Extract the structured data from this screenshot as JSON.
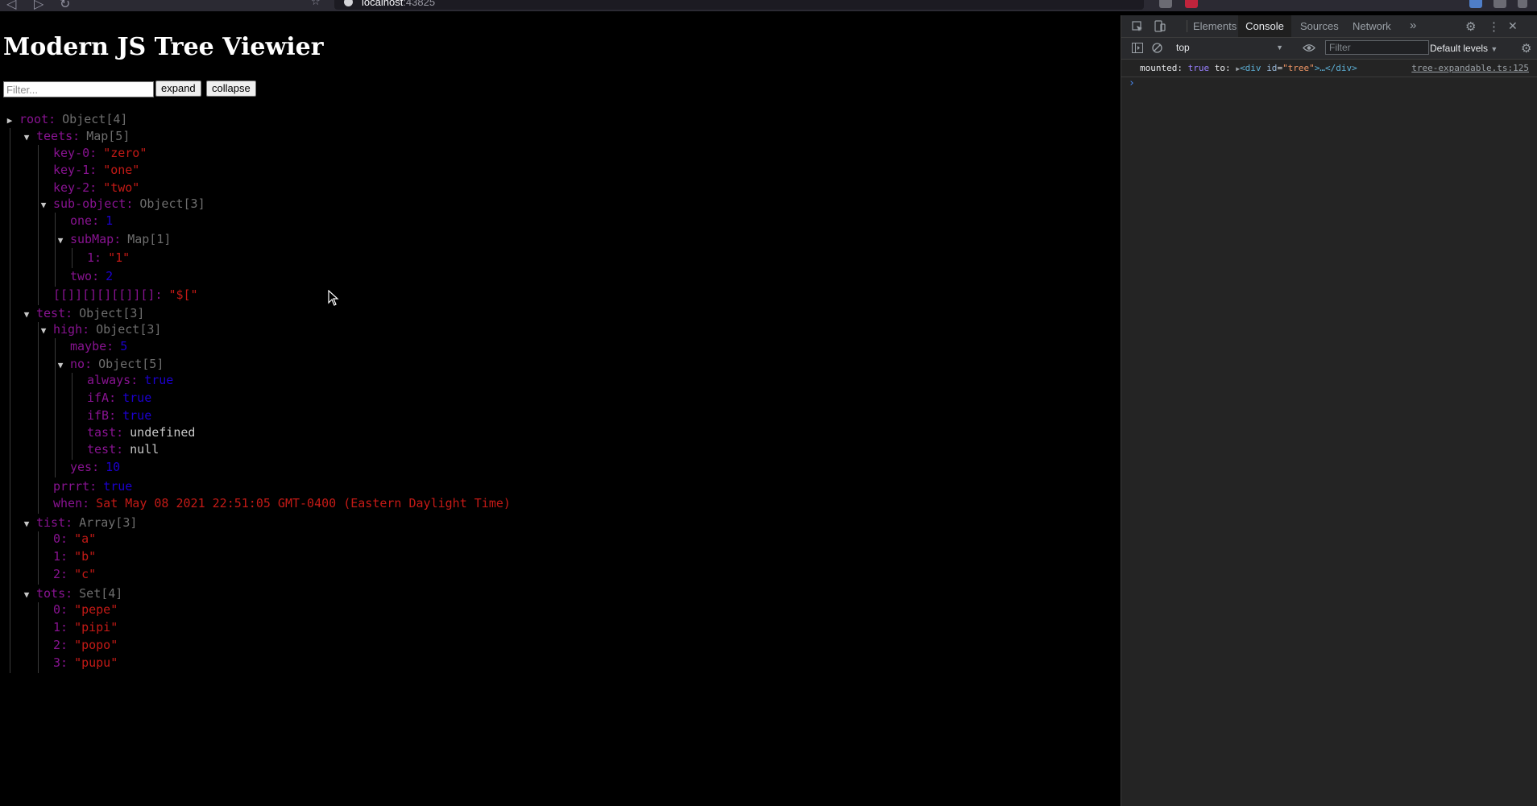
{
  "browser": {
    "url_host": "localhost",
    "url_port": ":43825"
  },
  "page": {
    "title": "Modern JS Tree Viewier",
    "filter_placeholder": "Filter...",
    "expand_label": "expand",
    "collapse_label": "collapse"
  },
  "tree": [
    {
      "key": "root",
      "type": "Object[4]",
      "collapsed": true,
      "depth": 0
    },
    {
      "key": "teets",
      "type": "Map[5]",
      "expanded": true,
      "depth": 1
    },
    {
      "key": "key-0",
      "value": "\"zero\"",
      "vclass": "s",
      "depth": 2
    },
    {
      "key": "key-1",
      "value": "\"one\"",
      "vclass": "s",
      "depth": 2
    },
    {
      "key": "key-2",
      "value": "\"two\"",
      "vclass": "s",
      "depth": 2
    },
    {
      "key": "sub-object",
      "type": "Object[3]",
      "expanded": true,
      "depth": 2
    },
    {
      "key": "one",
      "value": "1",
      "vclass": "n",
      "depth": 3
    },
    {
      "key": "subMap",
      "type": "Map[1]",
      "expanded": true,
      "depth": 3
    },
    {
      "key": "1",
      "value": "\"1\"",
      "vclass": "s",
      "depth": 4
    },
    {
      "key": "two",
      "value": "2",
      "vclass": "n",
      "depth": 3
    },
    {
      "key": "[[]][][][[]][]",
      "value": "\"$[\"",
      "vclass": "s",
      "depth": 2
    },
    {
      "key": "test",
      "type": "Object[3]",
      "expanded": true,
      "depth": 1
    },
    {
      "key": "high",
      "type": "Object[3]",
      "expanded": true,
      "depth": 2
    },
    {
      "key": "maybe",
      "value": "5",
      "vclass": "n",
      "depth": 3
    },
    {
      "key": "no",
      "type": "Object[5]",
      "expanded": true,
      "depth": 3
    },
    {
      "key": "always",
      "value": "true",
      "vclass": "n",
      "depth": 4
    },
    {
      "key": "ifA",
      "value": "true",
      "vclass": "n",
      "depth": 4
    },
    {
      "key": "ifB",
      "value": "true",
      "vclass": "n",
      "depth": 4
    },
    {
      "key": "tast",
      "value": "undefined",
      "vclass": "nil",
      "depth": 4
    },
    {
      "key": "test",
      "value": "null",
      "vclass": "nil",
      "depth": 4
    },
    {
      "key": "yes",
      "value": "10",
      "vclass": "n",
      "depth": 3
    },
    {
      "key": "prrrt",
      "value": "true",
      "vclass": "n",
      "depth": 2
    },
    {
      "key": "when",
      "value": "Sat May 08 2021 22:51:05 GMT-0400 (Eastern Daylight Time)",
      "vclass": "s",
      "depth": 2
    },
    {
      "key": "tist",
      "type": "Array[3]",
      "expanded": true,
      "depth": 1
    },
    {
      "key": "0",
      "value": "\"a\"",
      "vclass": "s",
      "depth": 2
    },
    {
      "key": "1",
      "value": "\"b\"",
      "vclass": "s",
      "depth": 2
    },
    {
      "key": "2",
      "value": "\"c\"",
      "vclass": "s",
      "depth": 2
    },
    {
      "key": "tots",
      "type": "Set[4]",
      "expanded": true,
      "depth": 1
    },
    {
      "key": "0",
      "value": "\"pepe\"",
      "vclass": "s",
      "depth": 2
    },
    {
      "key": "1",
      "value": "\"pipi\"",
      "vclass": "s",
      "depth": 2
    },
    {
      "key": "2",
      "value": "\"popo\"",
      "vclass": "s",
      "depth": 2
    },
    {
      "key": "3",
      "value": "\"pupu\"",
      "vclass": "s",
      "depth": 2
    }
  ],
  "devtools": {
    "tabs": [
      "Elements",
      "Console",
      "Sources",
      "Network"
    ],
    "active_tab": "Console",
    "more_tabs": "»",
    "context": "top",
    "filter_placeholder": "Filter",
    "levels": "Default levels",
    "log": {
      "text_mounted": "mounted:",
      "val_true": "true",
      "text_to": "to:",
      "tag_open": "<div",
      "attr_name": "id",
      "attr_val": "\"tree\"",
      "tag_rest": ">…</div>",
      "source": "tree-expandable.ts:125"
    },
    "prompt": "›"
  },
  "colors": {
    "key": "#881391",
    "string": "#c41a16",
    "number": "#1c00cf",
    "type": "#6e6e6e",
    "devtools_bg": "#242424"
  }
}
